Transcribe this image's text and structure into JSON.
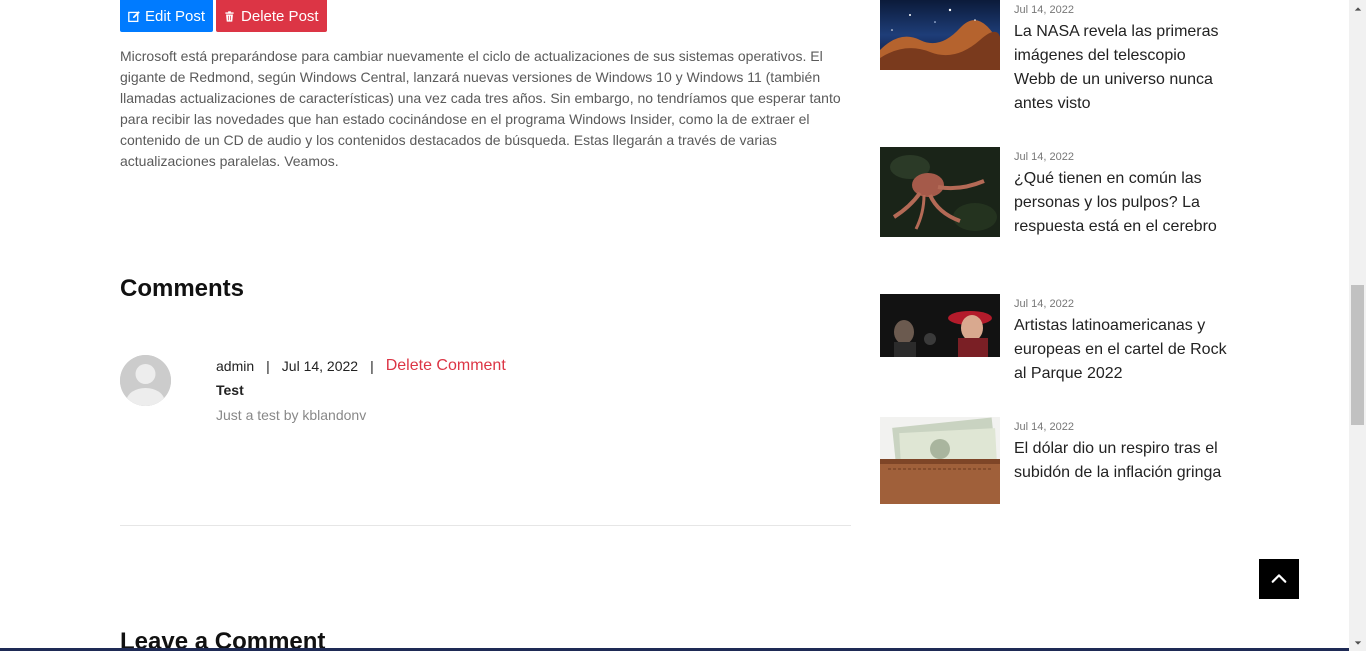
{
  "post": {
    "edit_label": "Edit Post",
    "delete_label": "Delete Post",
    "body": "Microsoft está preparándose para cambiar nuevamente el ciclo de actualizaciones de sus sistemas operativos. El gigante de Redmond, según Windows Central, lanzará nuevas versiones de Windows 10 y Windows 11 (también llamadas actualizaciones de características) una vez cada tres años. Sin embargo, no tendríamos que esperar tanto para recibir las novedades que han estado cocinándose en el programa Windows Insider, como la de extraer el contenido de un CD de audio y los contenidos destacados de búsqueda. Estas llegarán a través de varias actualizaciones paralelas. Veamos."
  },
  "comments": {
    "title": "Comments",
    "items": [
      {
        "author": "admin",
        "separator": "|",
        "date": "Jul 14, 2022",
        "delete_label": "Delete Comment",
        "title": "Test",
        "text": "Just a test by kblandonv"
      }
    ]
  },
  "leave_comment": {
    "title": "Leave a Comment"
  },
  "sidebar": {
    "posts": [
      {
        "date": "Jul 14, 2022",
        "title": "La NASA revela las primeras imágenes del telescopio Webb de un universo nunca antes visto",
        "image": "space-nebula-image"
      },
      {
        "date": "Jul 14, 2022",
        "title": "¿Qué tienen en común las personas y los pulpos? La respuesta está en el cerebro",
        "image": "octopus-image"
      },
      {
        "date": "Jul 14, 2022",
        "title": "Artistas latinoamericanas y europeas en el cartel de Rock al Parque 2022",
        "image": "concert-artists-image"
      },
      {
        "date": "Jul 14, 2022",
        "title": "El dólar dio un respiro tras el subidón de la inflación gringa",
        "image": "dollar-wallet-image"
      }
    ]
  },
  "icons": {
    "edit": "edit-icon",
    "trash": "trash-icon",
    "back_to_top": "chevron-up-icon"
  },
  "colors": {
    "edit_button": "#007bff",
    "delete_button": "#dc3545",
    "delete_link": "#dc3545",
    "back_to_top": "#000000"
  }
}
